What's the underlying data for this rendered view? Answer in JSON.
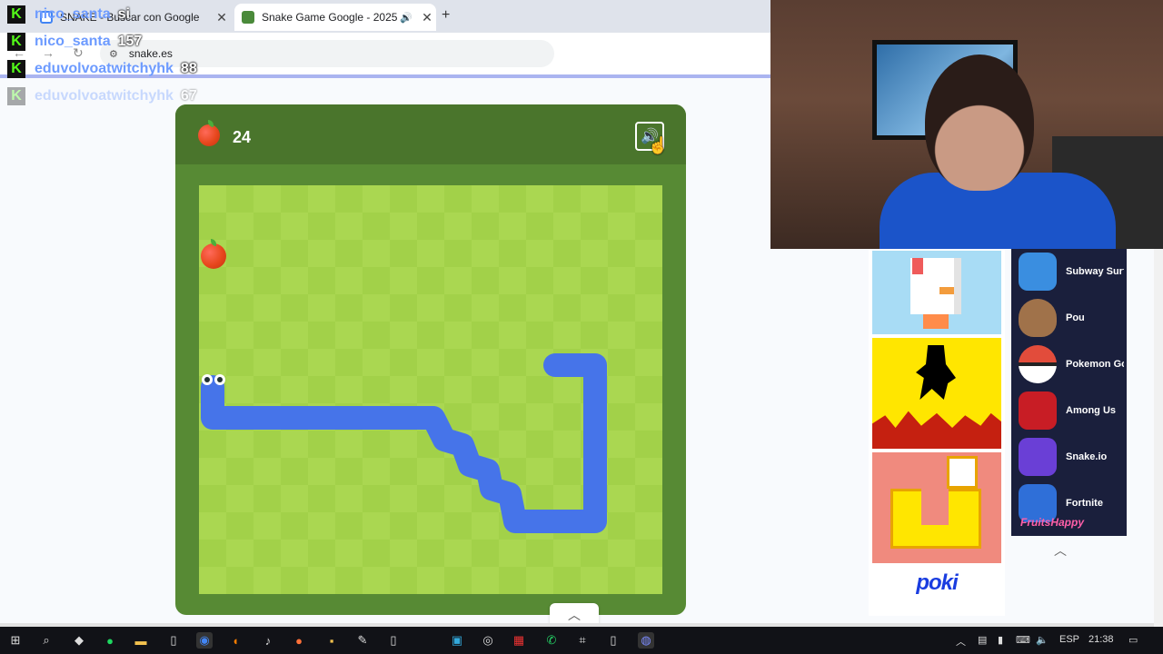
{
  "browser": {
    "tabs": [
      {
        "title": "SNAKE - Buscar con Google",
        "active": false
      },
      {
        "title": "Snake Game Google - 2025",
        "active": true
      }
    ],
    "new_tab": "+",
    "close_glyph": "✕",
    "url": "snake.es"
  },
  "chat": [
    {
      "user": "nico_santa",
      "message": "si",
      "faded": false
    },
    {
      "user": "nico_santa",
      "message": "157",
      "faded": false
    },
    {
      "user": "eduvolvoatwitchyhk",
      "message": "88",
      "faded": false
    },
    {
      "user": "eduvolvoatwitchyhk",
      "message": "67",
      "faded": true
    }
  ],
  "game": {
    "score": "24",
    "sound_icon": "speaker-icon",
    "colors": {
      "frame": "#578a34",
      "header": "#4a752c",
      "light": "#aad751",
      "dark": "#a2d149",
      "snake": "#4674e9"
    }
  },
  "poki": {
    "logo": "poki",
    "games": [
      {
        "name": "Subway Surfe",
        "color": "#3a8ee0"
      },
      {
        "name": "Pou",
        "color": "#a0724a"
      },
      {
        "name": "Pokemon Go",
        "color": "#e24c3b"
      },
      {
        "name": "Among Us",
        "color": "#c81d25"
      },
      {
        "name": "Snake.io",
        "color": "#6a3fd6"
      },
      {
        "name": "Fortnite",
        "color": "#2f6fd8"
      }
    ],
    "fortnite_banner": "FruitsHappy"
  },
  "taskbar": {
    "lang": "ESP",
    "time": "21:38"
  }
}
